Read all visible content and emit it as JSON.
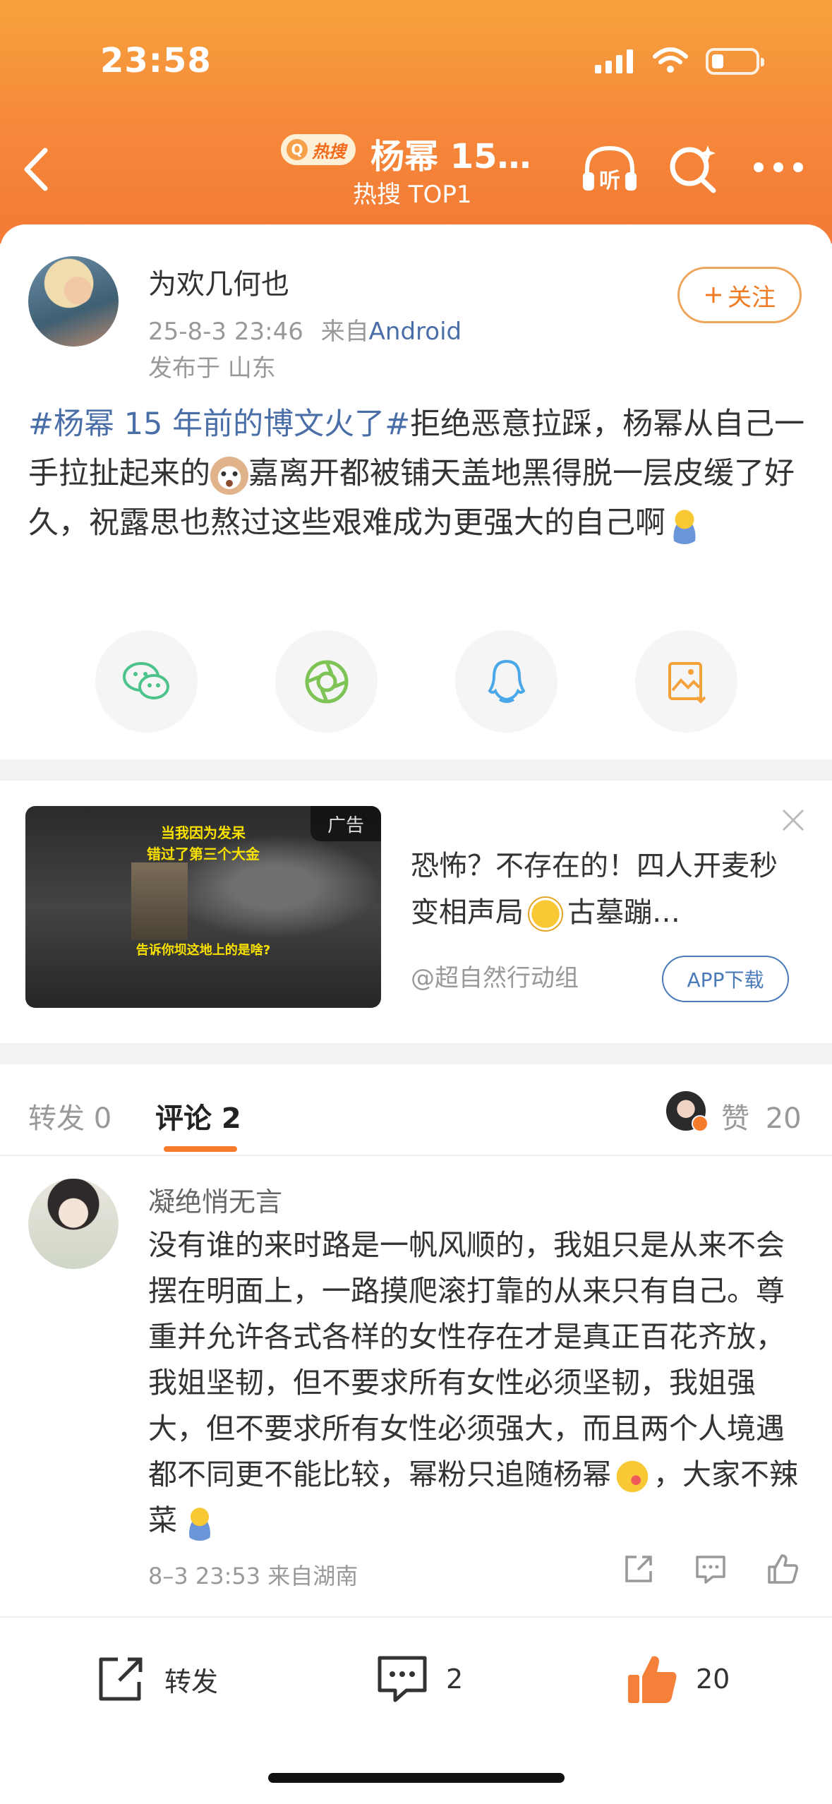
{
  "status_bar": {
    "time": "23:58"
  },
  "header": {
    "hot_badge": "热搜",
    "title": "杨幂 15…",
    "subtitle": "热搜 TOP1",
    "icons": [
      "back-icon",
      "listen-icon",
      "search-icon",
      "more-icon"
    ],
    "listen_label": "听"
  },
  "post": {
    "author": "为欢几何也",
    "date": "25-8-3 23:46",
    "source_prefix": "来自",
    "source": "Android",
    "location": "发布于 山东",
    "follow_label": "关注",
    "hashtag": "#杨幂 15 年前的博文火了#",
    "text_1": "拒绝恶意拉踩，杨幂从自己一手拉扯起来的",
    "text_2": "嘉离开都被铺天盖地黑得脱一层皮缓了好久，祝露思也熬过这些艰难成为更强大的自己啊",
    "share_icons": [
      "wechat-icon",
      "moments-icon",
      "qq-icon",
      "save-image-icon"
    ]
  },
  "ad": {
    "label": "广告",
    "thumb_caption_1": "当我因为发呆",
    "thumb_caption_2": "错过了第三个大金",
    "thumb_caption_3": "告诉你坝这地上的是啥?",
    "title_1": "恐怖？不存在的！四人开麦秒变相声局",
    "title_2": "古墓蹦…",
    "source": "@超自然行动组",
    "download_label": "APP下载"
  },
  "comments_tabs": {
    "repost": "转发 0",
    "comment": "评论 2",
    "like_label": "赞",
    "like_count": "20"
  },
  "comment": {
    "author": "凝绝悄无言",
    "text_1": "没有谁的来时路是一帆风顺的，我姐只是从来不会摆在明面上，一路摸爬滚打靠的从来只有自己。尊重并允许各式各样的女性存在才是真正百花齐放，我姐坚韧，但不要求所有女性必须坚韧，我姐强大，但不要求所有女性必须强大，而且两个人境遇都不同更不能比较，幂粉只追随杨幂",
    "text_2": "，大家不辣菜",
    "meta": "8–3 23:53 来自湖南"
  },
  "bottom_bar": {
    "repost_label": "转发",
    "comment_count": "2",
    "like_count": "20"
  },
  "colors": {
    "header_orange": "#f5873a",
    "link_blue": "#4a6ea8",
    "accent_orange": "#f57c2c"
  }
}
